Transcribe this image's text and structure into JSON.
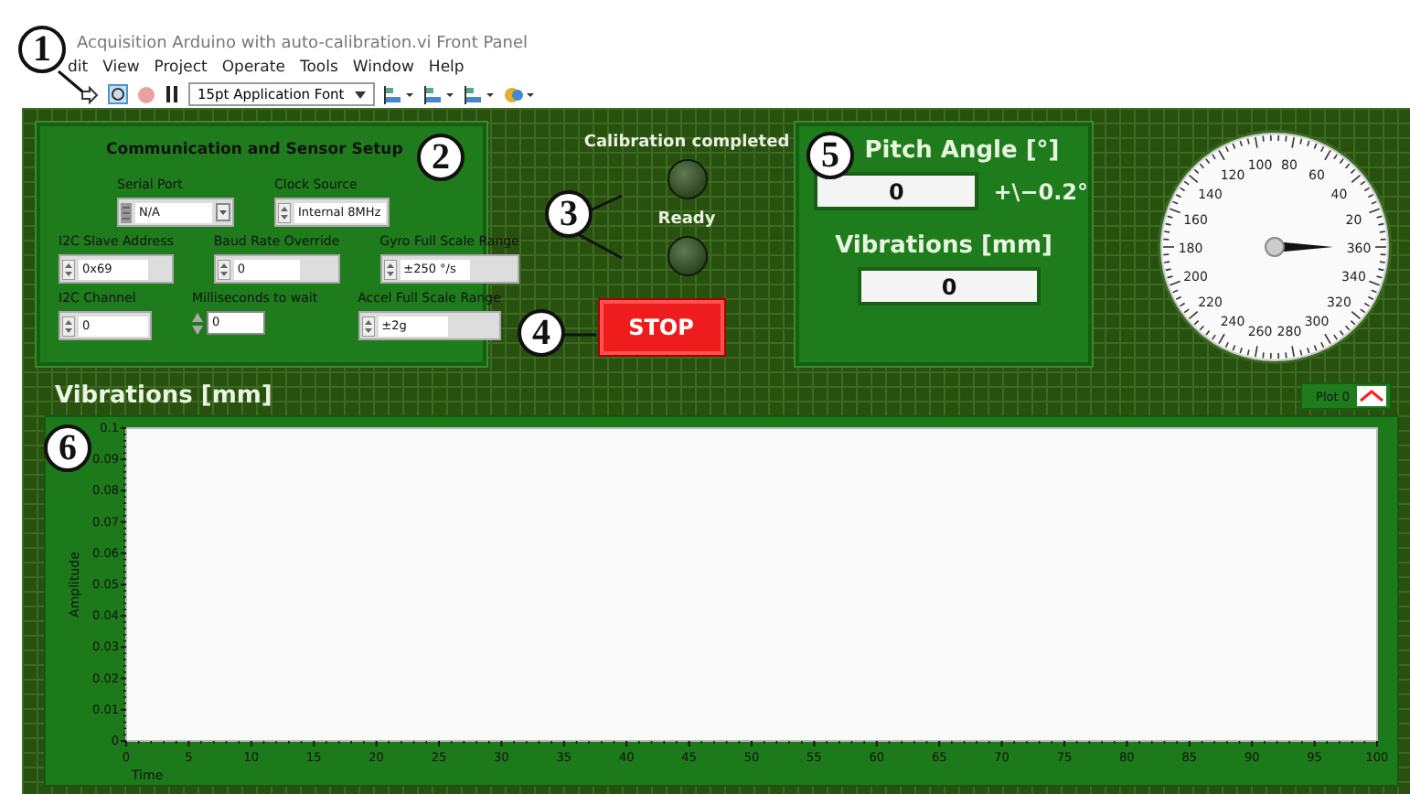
{
  "window": {
    "title": "Acquisition Arduino with auto-calibration.vi Front Panel"
  },
  "menu": [
    "dit",
    "View",
    "Project",
    "Operate",
    "Tools",
    "Window",
    "Help"
  ],
  "toolbar": {
    "font_menu": "15pt Application Font"
  },
  "callouts": [
    "1",
    "2",
    "3",
    "4",
    "5",
    "6"
  ],
  "setup": {
    "title": "Communication and Sensor Setup",
    "rows": [
      [
        {
          "kind": "resource",
          "label": "Serial Port",
          "value": "N/A"
        },
        {
          "kind": "numeric",
          "label": "Clock Source",
          "value": "Internal 8MHz"
        }
      ],
      [
        {
          "kind": "numeric",
          "label": "I2C Slave Address",
          "value": "0x69"
        },
        {
          "kind": "numeric",
          "label": "Baud Rate Override",
          "value": "0"
        },
        {
          "kind": "numeric",
          "label": "Gyro Full Scale Range",
          "value": "±250 °/s"
        }
      ],
      [
        {
          "kind": "numeric",
          "label": "I2C Channel",
          "value": "0"
        },
        {
          "kind": "compact",
          "label": "Milliseconds to wait",
          "value": "0"
        },
        {
          "kind": "numeric",
          "label": "Accel Full Scale Range",
          "value": "±2g"
        }
      ]
    ]
  },
  "leds": [
    {
      "label": "Calibration completed",
      "on": false
    },
    {
      "label": "Ready",
      "on": false
    }
  ],
  "stop_button": {
    "label": "STOP"
  },
  "pitch": {
    "title": "Pitch Angle [°]",
    "value": "0",
    "tolerance": "+\\−0.2°",
    "vib_title": "Vibrations [mm]",
    "vib_value": "0"
  },
  "gauge": {
    "labels": [
      "100",
      "80",
      "120",
      "60",
      "140",
      "40",
      "160",
      "20",
      "180",
      "360",
      "200",
      "340",
      "220",
      "320",
      "240",
      "300",
      "260",
      "280"
    ]
  },
  "graph": {
    "title": "Vibrations [mm]",
    "legend": [
      {
        "name": "Plot 0",
        "color": "#ff2020"
      }
    ],
    "chart_data": {
      "type": "line",
      "xlabel": "Time",
      "ylabel": "Amplitude",
      "xlim": [
        0,
        100
      ],
      "ylim": [
        0,
        0.1
      ],
      "xticks": [
        0,
        5,
        10,
        15,
        20,
        25,
        30,
        35,
        40,
        45,
        50,
        55,
        60,
        65,
        70,
        75,
        80,
        85,
        90,
        95,
        100
      ],
      "yticks": [
        0,
        {
          "value": 0.01,
          "label": "0.01"
        },
        {
          "value": 0.02,
          "label": "0.02"
        },
        {
          "value": 0.03,
          "label": "0.03"
        },
        {
          "value": 0.04,
          "label": "0.04"
        },
        {
          "value": 0.05,
          "label": "0.05"
        },
        {
          "value": 0.06,
          "label": "0.06"
        },
        {
          "value": 0.07,
          "label": "0.07"
        },
        {
          "value": 0.08,
          "label": "0.08"
        },
        {
          "value": 0.09,
          "label": "0.09"
        },
        {
          "value": 0.1,
          "label": "0.1"
        }
      ]
    }
  }
}
